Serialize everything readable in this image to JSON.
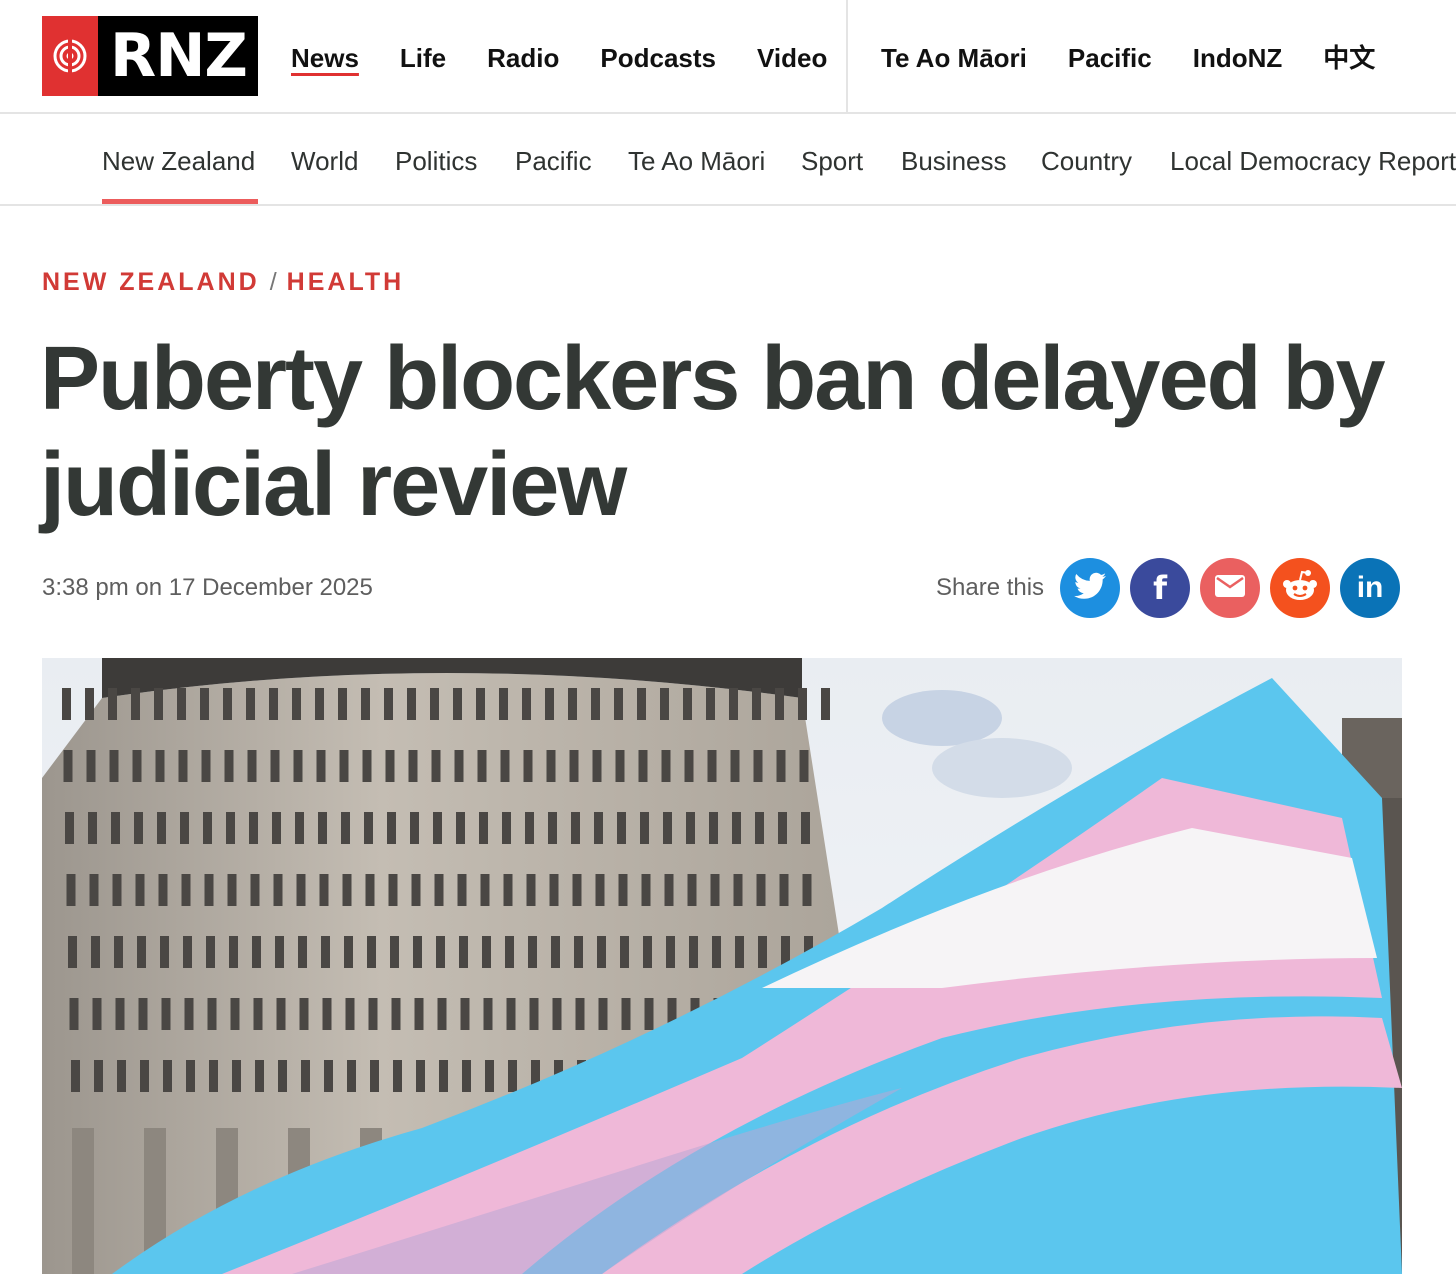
{
  "brand": {
    "logo_text": "RNZ",
    "accent": "#e03131"
  },
  "primary_nav": [
    {
      "label": "News",
      "active": true
    },
    {
      "label": "Life"
    },
    {
      "label": "Radio"
    },
    {
      "label": "Podcasts"
    },
    {
      "label": "Video"
    }
  ],
  "alt_nav": [
    {
      "label": "Te Ao Māori"
    },
    {
      "label": "Pacific"
    },
    {
      "label": "IndoNZ"
    },
    {
      "label": "中文"
    }
  ],
  "section_nav": [
    {
      "label": "New Zealand",
      "active": true
    },
    {
      "label": "World"
    },
    {
      "label": "Politics"
    },
    {
      "label": "Pacific"
    },
    {
      "label": "Te Ao Māori"
    },
    {
      "label": "Sport"
    },
    {
      "label": "Business"
    },
    {
      "label": "Country"
    },
    {
      "label": "Local Democracy Reporting"
    }
  ],
  "article": {
    "category": "NEW ZEALAND",
    "separator": "/",
    "subcategory": "HEALTH",
    "headline": "Puberty blockers ban delayed by judicial review",
    "timestamp": "3:38 pm on 17 December 2025"
  },
  "share": {
    "label": "Share this",
    "buttons": [
      {
        "name": "twitter",
        "icon": "twitter-bird-icon",
        "color": "#1d8fe0"
      },
      {
        "name": "facebook",
        "icon": "facebook-f-icon",
        "color": "#3a4a9c"
      },
      {
        "name": "email",
        "icon": "envelope-icon",
        "color": "#ea6060"
      },
      {
        "name": "reddit",
        "icon": "reddit-alien-icon",
        "color": "#f4511e"
      },
      {
        "name": "linkedin",
        "icon": "linkedin-in-icon",
        "color": "#0a73b7"
      }
    ],
    "facebook_glyph": "f",
    "linkedin_glyph": "in"
  },
  "hero_image": {
    "subject": "Beehive parliament building with transgender pride flag",
    "flag_colors": [
      "#5bc6ee",
      "#efb8d8",
      "#f6f4f6"
    ]
  }
}
